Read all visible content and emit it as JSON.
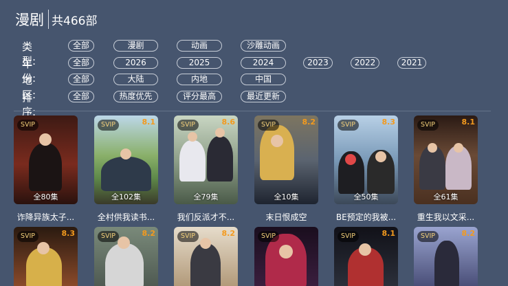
{
  "header": {
    "title": "漫剧",
    "count": "共466部"
  },
  "filters": [
    {
      "label": "类型:",
      "options": [
        "全部",
        "漫剧",
        "动画",
        "沙雕动画"
      ]
    },
    {
      "label": "年份:",
      "options": [
        "全部",
        "2026",
        "2025",
        "2024",
        "2023",
        "2022",
        "2021"
      ]
    },
    {
      "label": "地区:",
      "options": [
        "全部",
        "大陆",
        "内地",
        "中国"
      ]
    },
    {
      "label": "排序:",
      "options": [
        "全部",
        "热度优先",
        "评分最高",
        "最近更新"
      ]
    }
  ],
  "cards_row1": [
    {
      "title": "诈降异族太子...",
      "episodes": "全80集",
      "badge": "SVIP",
      "score": "",
      "color": "#7a2b1e"
    },
    {
      "title": "全村供我读书...",
      "episodes": "全102集",
      "badge": "SVIP",
      "score": "8.1",
      "color": "#5f8a4a"
    },
    {
      "title": "我们反派才不...",
      "episodes": "全79集",
      "badge": "SVIP",
      "score": "8.6",
      "color": "#8fa08a"
    },
    {
      "title": "末日恨成空",
      "episodes": "全10集",
      "badge": "SVIP",
      "score": "8.2",
      "color": "#5b6470"
    },
    {
      "title": "BE预定的我被...",
      "episodes": "全50集",
      "badge": "SVIP",
      "score": "8.3",
      "color": "#7a9ab8"
    },
    {
      "title": "重生我以文采...",
      "episodes": "全61集",
      "badge": "SVIP",
      "score": "8.1",
      "color": "#6a4a36"
    }
  ],
  "cards_row2": [
    {
      "badge": "SVIP",
      "score": "8.3",
      "color": "#8a4a2a"
    },
    {
      "badge": "SVIP",
      "score": "8.2",
      "color": "#4f5a52"
    },
    {
      "badge": "SVIP",
      "score": "8.2",
      "color": "#b29a7a"
    },
    {
      "badge": "SVIP",
      "score": "",
      "color": "#3a1e3e"
    },
    {
      "badge": "SVIP",
      "score": "8.1",
      "color": "#2b2f3a"
    },
    {
      "badge": "SVIP",
      "score": "8.2",
      "color": "#4a4f78"
    }
  ]
}
